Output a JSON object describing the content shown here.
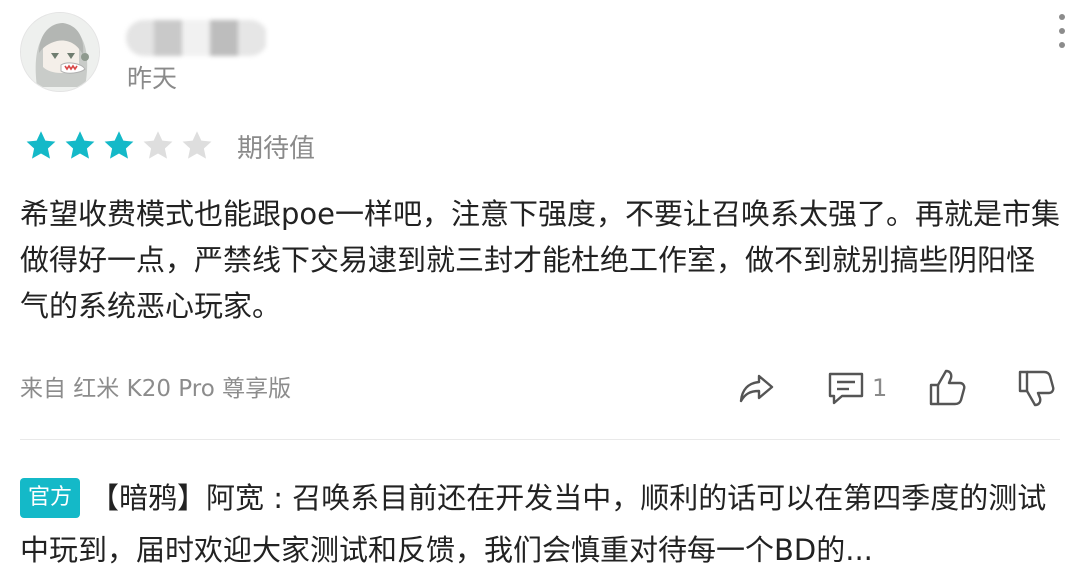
{
  "review": {
    "author": {
      "date": "昨天"
    },
    "rating": {
      "filled_stars": 3,
      "total_stars": 5,
      "label": "期待值"
    },
    "text": "希望收费模式也能跟poe一样吧，注意下强度，不要让召唤系太强了。再就是市集做得好一点，严禁线下交易逮到就三封才能杜绝工作室，做不到就别搞些阴阳怪气的系统恶心玩家。",
    "device": "来自 红米 K20 Pro 尊享版",
    "actions": {
      "share_icon": "share-icon",
      "comment_icon": "comment-icon",
      "comment_count": "1",
      "like_icon": "thumbs-up-icon",
      "dislike_icon": "thumbs-down-icon"
    }
  },
  "official_reply": {
    "badge": "官方",
    "text": "【暗鸦】阿宽 : 召唤系目前还在开发当中，顺利的话可以在第四季度的测试中玩到，届时欢迎大家测试和反馈，我们会慎重对待每一个BD的..."
  },
  "colors": {
    "accent": "#14b9c8",
    "star_filled": "#14b9c8",
    "star_empty": "#dedede",
    "muted_text": "#8a8a8a"
  }
}
